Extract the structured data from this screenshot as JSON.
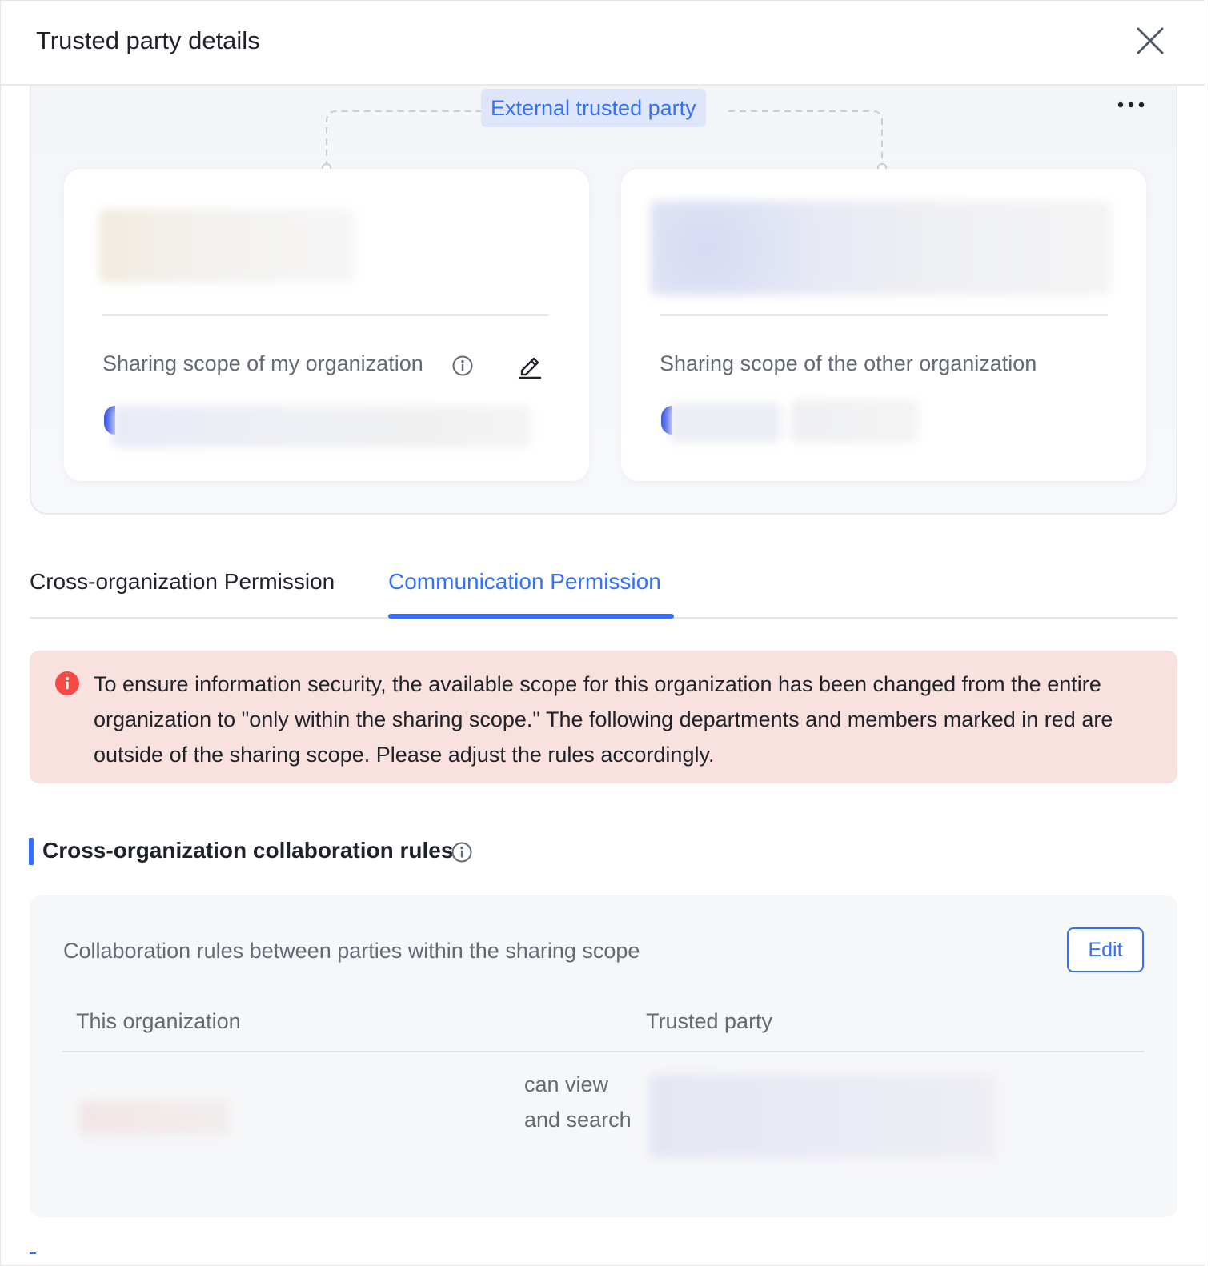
{
  "dialog": {
    "title": "Trusted party details"
  },
  "org_overview": {
    "badge": "External trusted party",
    "my_org": {
      "scope_label": "Sharing scope of my organization"
    },
    "other_org": {
      "scope_label": "Sharing scope of the other organization"
    }
  },
  "tabs": [
    {
      "label": "Cross-organization Permission",
      "selected": false
    },
    {
      "label": "Communication Permission",
      "selected": true
    }
  ],
  "alert": {
    "message": "To ensure information security, the available scope for this organization has been changed from the entire organization to \"only within the sharing scope.\" The following departments and members marked in red are outside of the sharing scope. Please adjust the rules accordingly."
  },
  "collaboration": {
    "section_title": "Cross-organization collaboration rules",
    "description": "Collaboration rules between parties within the sharing scope",
    "edit_label": "Edit",
    "columns": {
      "this_org": "This organization",
      "trusted_party": "Trusted party"
    },
    "rows": [
      {
        "relation": "can view and search"
      }
    ]
  },
  "colors": {
    "accent": "#3370ff",
    "alert_bg": "#f9e1df",
    "alert_icon": "#f54a45"
  }
}
